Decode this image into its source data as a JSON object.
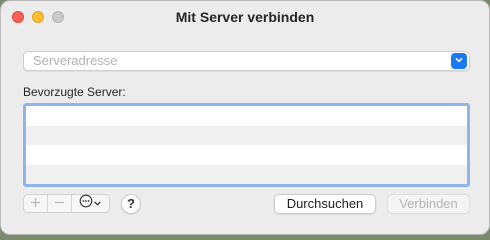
{
  "window": {
    "title": "Mit Server verbinden"
  },
  "server_address": {
    "value": "",
    "placeholder": "Serveradresse",
    "dropdown_icon": "chevron-down-icon"
  },
  "favorites": {
    "label": "Bevorzugte Server:",
    "rows": [],
    "selection_color": "#8fb5ea"
  },
  "toolbar": {
    "add_icon": "plus-icon",
    "remove_icon": "minus-icon",
    "action_icon": "ellipsis-circle-icon",
    "help_label": "?",
    "browse_label": "Durchsuchen",
    "connect_label": "Verbinden"
  },
  "colors": {
    "accent": "#1a78f2",
    "close": "#fe5f57",
    "minimize": "#febc2e"
  }
}
